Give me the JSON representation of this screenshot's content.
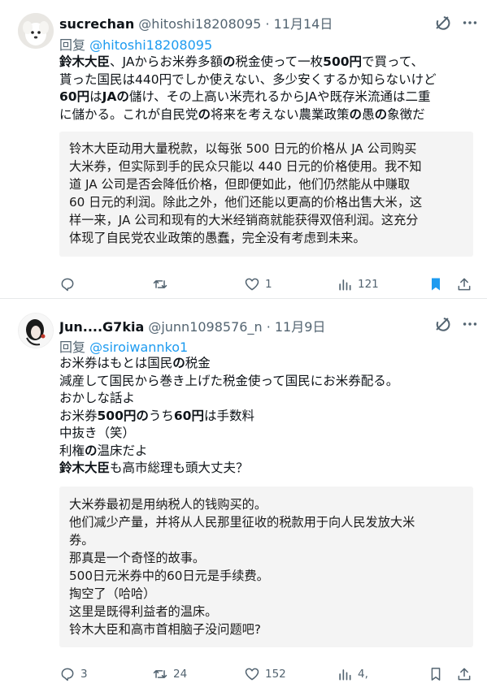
{
  "tweets": [
    {
      "name": "sucrechan",
      "handle": "@hitoshi18208095",
      "date": "11月14日",
      "reply_prefix": "回复",
      "reply_to": "@hitoshi18208095",
      "lines": [
        [
          {
            "t": "鈴木大臣",
            "b": true
          },
          {
            "t": "、JAからお米券多額"
          },
          {
            "t": "の",
            "b": true
          },
          {
            "t": "税金使って一枚"
          },
          {
            "t": "500円",
            "b": true
          },
          {
            "t": "で買って、"
          }
        ],
        [
          {
            "t": "貰った国民は440円でしか使えない、多少安くするか知らないけど"
          }
        ],
        [
          {
            "t": "60円",
            "b": true
          },
          {
            "t": "は"
          },
          {
            "t": "JAの",
            "b": true
          },
          {
            "t": "儲け、その上高い米売れるからJAや既存米流通は二重"
          }
        ],
        [
          {
            "t": "に儲かる。これが自民党"
          },
          {
            "t": "の",
            "b": true
          },
          {
            "t": "将来を考えない農業政策"
          },
          {
            "t": "の",
            "b": true
          },
          {
            "t": "愚"
          },
          {
            "t": "の",
            "b": true
          },
          {
            "t": "象徴だ"
          }
        ]
      ],
      "translation": [
        "铃木大臣动用大量税款，以每张 500 日元的价格从 JA 公司购买",
        "大米券，但实际到手的民众只能以 440 日元的价格使用。我不知",
        "道 JA 公司是否会降低价格，但即便如此，他们仍然能从中赚取",
        "60 日元的利润。除此之外，他们还能以更高的价格出售大米，这",
        "样一来，JA 公司和现有的大米经销商就能获得双倍利润。这充分",
        "体现了自民党农业政策的愚蠢，完全没有考虑到未来。"
      ],
      "counts": {
        "replies": "",
        "retweets": "",
        "likes": "1",
        "views": "121"
      }
    },
    {
      "name": "Jun....G7kia",
      "handle": "@junn1098576_n",
      "date": "11月9日",
      "reply_prefix": "回复",
      "reply_to": "@siroiwannko1",
      "lines": [
        [
          {
            "t": "お米券はもとは国民"
          },
          {
            "t": "の",
            "b": true
          },
          {
            "t": "税金"
          }
        ],
        [
          {
            "t": "減産して国民から巻き上げた税金使って国民にお米券配る。"
          }
        ],
        [
          {
            "t": "おかしな話よ"
          }
        ],
        [
          {
            "t": "お米券"
          },
          {
            "t": "500円の",
            "b": true
          },
          {
            "t": "うち"
          },
          {
            "t": "60円",
            "b": true
          },
          {
            "t": "は手数料"
          }
        ],
        [
          {
            "t": "中抜き（笑）"
          }
        ],
        [
          {
            "t": "利権"
          },
          {
            "t": "の",
            "b": true
          },
          {
            "t": "温床だよ"
          }
        ],
        [
          {
            "t": "鈴木大臣",
            "b": true
          },
          {
            "t": "も高市総理も頭大丈夫？"
          }
        ]
      ],
      "translation": [
        "大米券最初是用纳税人的钱购买的。",
        "他们减少产量，并将从人民那里征收的税款用于向人民发放大米",
        "券。",
        "那真是一个奇怪的故事。",
        "500日元米券中的60日元是手续费。",
        "掏空了（哈哈）",
        "这里是既得利益者的温床。",
        "铃木大臣和高市首相脑子没问题吧?"
      ],
      "counts": {
        "replies": "3",
        "retweets": "24",
        "likes": "152",
        "views": "4,"
      }
    }
  ],
  "colors": {
    "accent": "#1d9bf0",
    "muted": "#536471",
    "bookmark": "#1d9bf0",
    "translation_bg": "#f4f4f4"
  }
}
